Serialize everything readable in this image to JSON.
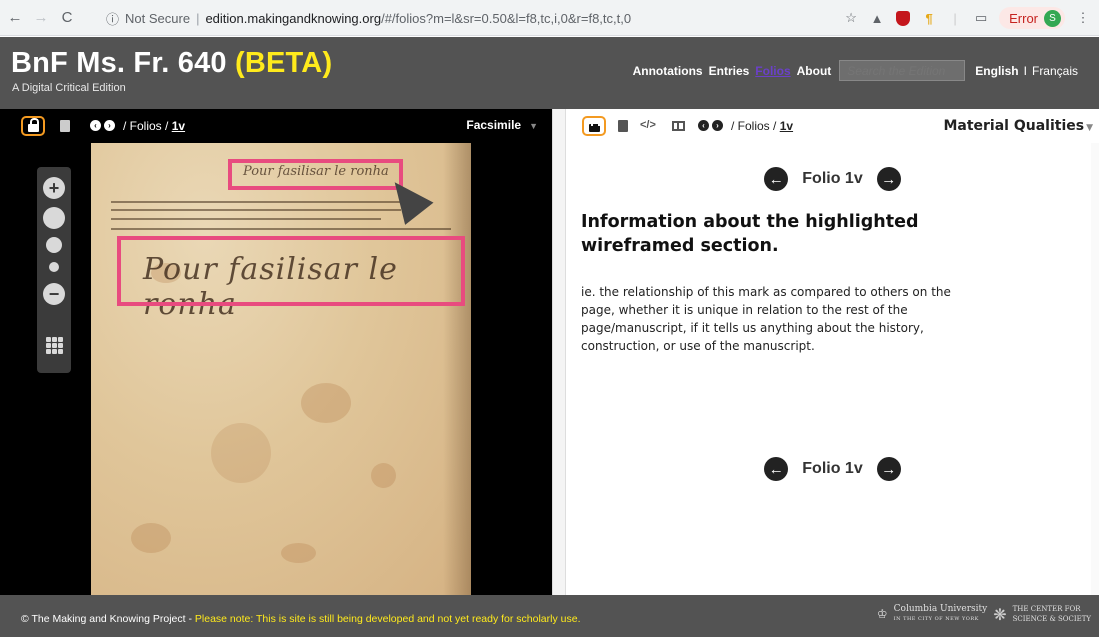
{
  "browser": {
    "security_label": "Not Secure",
    "url_host": "edition.makingandknowing.org",
    "url_path": "/#/folios?m=l&sr=0.50&l=f8,tc,i,0&r=f8,tc,t,0",
    "error_label": "Error",
    "avatar_initial": "S"
  },
  "site": {
    "title": "BnF Ms. Fr. 640",
    "beta": "(BETA)",
    "subtitle": "A Digital Critical Edition",
    "nav": {
      "annotations": "Annotations",
      "entries": "Entries",
      "folios": "Folios",
      "about": "About",
      "search_placeholder": "Search the Edition",
      "lang_english": "English",
      "lang_sep": "I",
      "lang_french": "Français"
    }
  },
  "left_pane": {
    "breadcrumb_prefix": "/ Folios /",
    "folio": "1v",
    "view_mode": "Facsimile",
    "manuscript_heading": "Pour fasilisar le ronha",
    "manuscript_large": "Pour fasilisar le ronha"
  },
  "right_pane": {
    "breadcrumb_prefix": "/ Folios /",
    "folio": "1v",
    "dropdown": "Material Qualities",
    "folio_nav_label": "Folio 1v",
    "info_heading": "Information about the highlighted wireframed section.",
    "info_body": "ie. the relationship of this mark as compared to others on the page, whether it is unique in relation to the rest of the page/manuscript, if it tells us anything about the history, construction, or use of the manuscript."
  },
  "footer": {
    "copyright": "© The Making and Knowing Project - ",
    "note": "Please note: This is site is still being developed and not yet ready for scholarly use.",
    "columbia": "Columbia University",
    "columbia_sub": "IN THE CITY OF NEW YORK",
    "center_line1": "THE CENTER FOR",
    "center_line2": "SCIENCE & SOCIETY"
  },
  "colors": {
    "header_bg": "#535353",
    "beta_yellow": "#ffea1c",
    "lock_orange": "#f39a21",
    "highlight_pink": "#e84b7f",
    "active_nav": "#6b40c9"
  },
  "icons": [
    "back-arrow-icon",
    "forward-arrow-icon",
    "reload-icon",
    "info-icon",
    "star-icon",
    "drive-icon",
    "ublock-icon",
    "paragraph-icon",
    "cast-icon",
    "menu-dots-icon",
    "lock-icon",
    "book-icon",
    "code-icon",
    "columns-icon",
    "prev-circle-icon",
    "next-circle-icon",
    "zoom-in-icon",
    "zoom-out-icon",
    "grid-icon"
  ]
}
